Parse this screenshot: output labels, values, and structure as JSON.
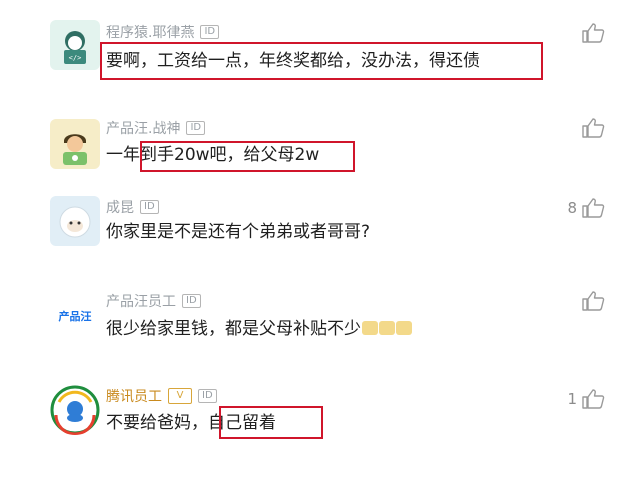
{
  "colors": {
    "highlight": "#d0152b",
    "name_gray": "#9aa0a6",
    "name_gold": "#c98a1e",
    "text": "#1f1f1f"
  },
  "comments": [
    {
      "user": "程序猿.耶律燕",
      "id_badge": "ID",
      "avatar_icon": "programmer-avatar-icon",
      "text": "要啊，工资给一点，年终奖都给，没办法，得还债",
      "likes": ""
    },
    {
      "user": "产品汪.战神",
      "id_badge": "ID",
      "avatar_icon": "pm-avatar-icon",
      "text_prefix": "一年",
      "text_highlight": "到手20w吧，给父母2w",
      "likes": ""
    },
    {
      "user": "成昆",
      "id_badge": "ID",
      "avatar_icon": "sheep-avatar-icon",
      "text": "你家里是不是还有个弟弟或者哥哥?",
      "likes": "8"
    },
    {
      "user": "产品汪员工",
      "id_badge": "ID",
      "avatar_text": "产品汪",
      "text": "很少给家里钱，都是父母补贴不少",
      "emojis": [
        "cry-laugh-emoji",
        "cry-laugh-emoji",
        "cry-laugh-emoji"
      ],
      "likes": ""
    },
    {
      "user": "腾讯员工",
      "v_badge": "V",
      "id_badge": "ID",
      "avatar_icon": "tencent-logo-icon",
      "text_prefix": "不要给爸妈，",
      "text_highlight": "自己留着",
      "likes": "1"
    }
  ]
}
